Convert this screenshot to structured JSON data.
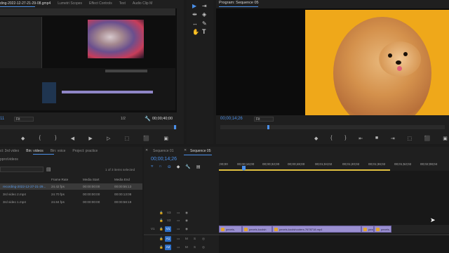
{
  "source_panel": {
    "tabs": [
      "ding-2022-12-27-21-29-08.gmp4",
      "Lumetri Scopes",
      "Effect Controls",
      "Text",
      "Audio Clip M"
    ],
    "fit": "Fit",
    "ratio": "1/2",
    "timecode_left": "11",
    "timecode_right": "00;00;40;00"
  },
  "tools": {
    "items": [
      "selection-tool",
      "track-select-tool",
      "ripple-edit-tool",
      "razor-tool",
      "slip-tool",
      "pen-tool",
      "hand-tool",
      "type-tool"
    ]
  },
  "program_panel": {
    "title": "Program: Sequence 05",
    "timecode": "00;00;14;26",
    "fit": "Fit"
  },
  "project_panel": {
    "tabs": [
      "ct: 3rd video",
      "Bin: videos",
      "Bin: voice",
      "Project: practice"
    ],
    "path": "ppro/videos",
    "selection_info": "1 of 3 items selected",
    "columns": [
      "Frame Rate",
      "Media Start",
      "Media End"
    ],
    "items": [
      {
        "name": "recording-2022-12-27-21-29...",
        "frame_rate": "24.42 fps",
        "start": "00:00:00:00",
        "end": "00:00:55:13"
      },
      {
        "name": "3rd video 2.mp4",
        "frame_rate": "24.70 fps",
        "start": "00:00:00:00",
        "end": "00:00:13:08"
      },
      {
        "name": "3rd video 1.mp4",
        "frame_rate": "24.84 fps",
        "start": "00:00:00:00",
        "end": "00:00:58:19"
      }
    ]
  },
  "timeline": {
    "tabs": [
      "Sequence 01",
      "Sequence 05"
    ],
    "timecode": "00;00;14;26",
    "ruler": [
      ";00;00",
      "00;00;16;00",
      "00;00;32;00",
      "00;00;48;00",
      "00;01;04;02",
      "00;01;20;02",
      "00;01;36;02",
      "00;01;52;02",
      "00;02;08;04"
    ],
    "tracks": {
      "v3": "V3",
      "v2": "V2",
      "v1_src": "V1",
      "v1": "V1",
      "a1": "A1",
      "a2": "A2",
      "m": "M",
      "s": "S"
    },
    "clips": [
      "pexels-",
      "pexels-koolsh",
      "pexels-koolshooters-7678718.mp4",
      "pexels",
      "pexels-"
    ]
  },
  "colors": {
    "accent": "#4a8fe8",
    "clip": "#9a8fd0",
    "program_bg": "#f0a91b"
  }
}
